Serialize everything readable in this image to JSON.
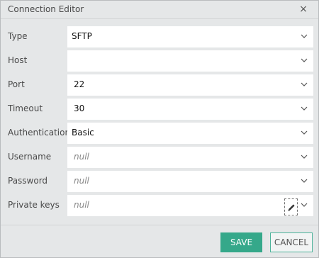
{
  "window": {
    "title": "Connection Editor",
    "close_glyph": "×"
  },
  "fields": [
    {
      "label": "Type",
      "value": "SFTP",
      "is_null": false
    },
    {
      "label": "Host",
      "value": "",
      "is_null": false
    },
    {
      "label": "Port",
      "value": "22",
      "is_null": false
    },
    {
      "label": "Timeout",
      "value": "30",
      "is_null": false
    },
    {
      "label": "Authentication",
      "value": "Basic",
      "is_null": false
    },
    {
      "label": "Username",
      "value": "null",
      "is_null": true
    },
    {
      "label": "Password",
      "value": "null",
      "is_null": true
    },
    {
      "label": "Private keys",
      "value": "null",
      "is_null": true
    }
  ],
  "buttons": {
    "save": "SAVE",
    "cancel": "CANCEL"
  },
  "colors": {
    "accent": "#35a88a",
    "background": "#e5e7e8",
    "field": "#ffffff"
  },
  "icons": {
    "dropdown": "chevron-down-icon",
    "edit": "pencil-icon",
    "close": "close-icon"
  }
}
